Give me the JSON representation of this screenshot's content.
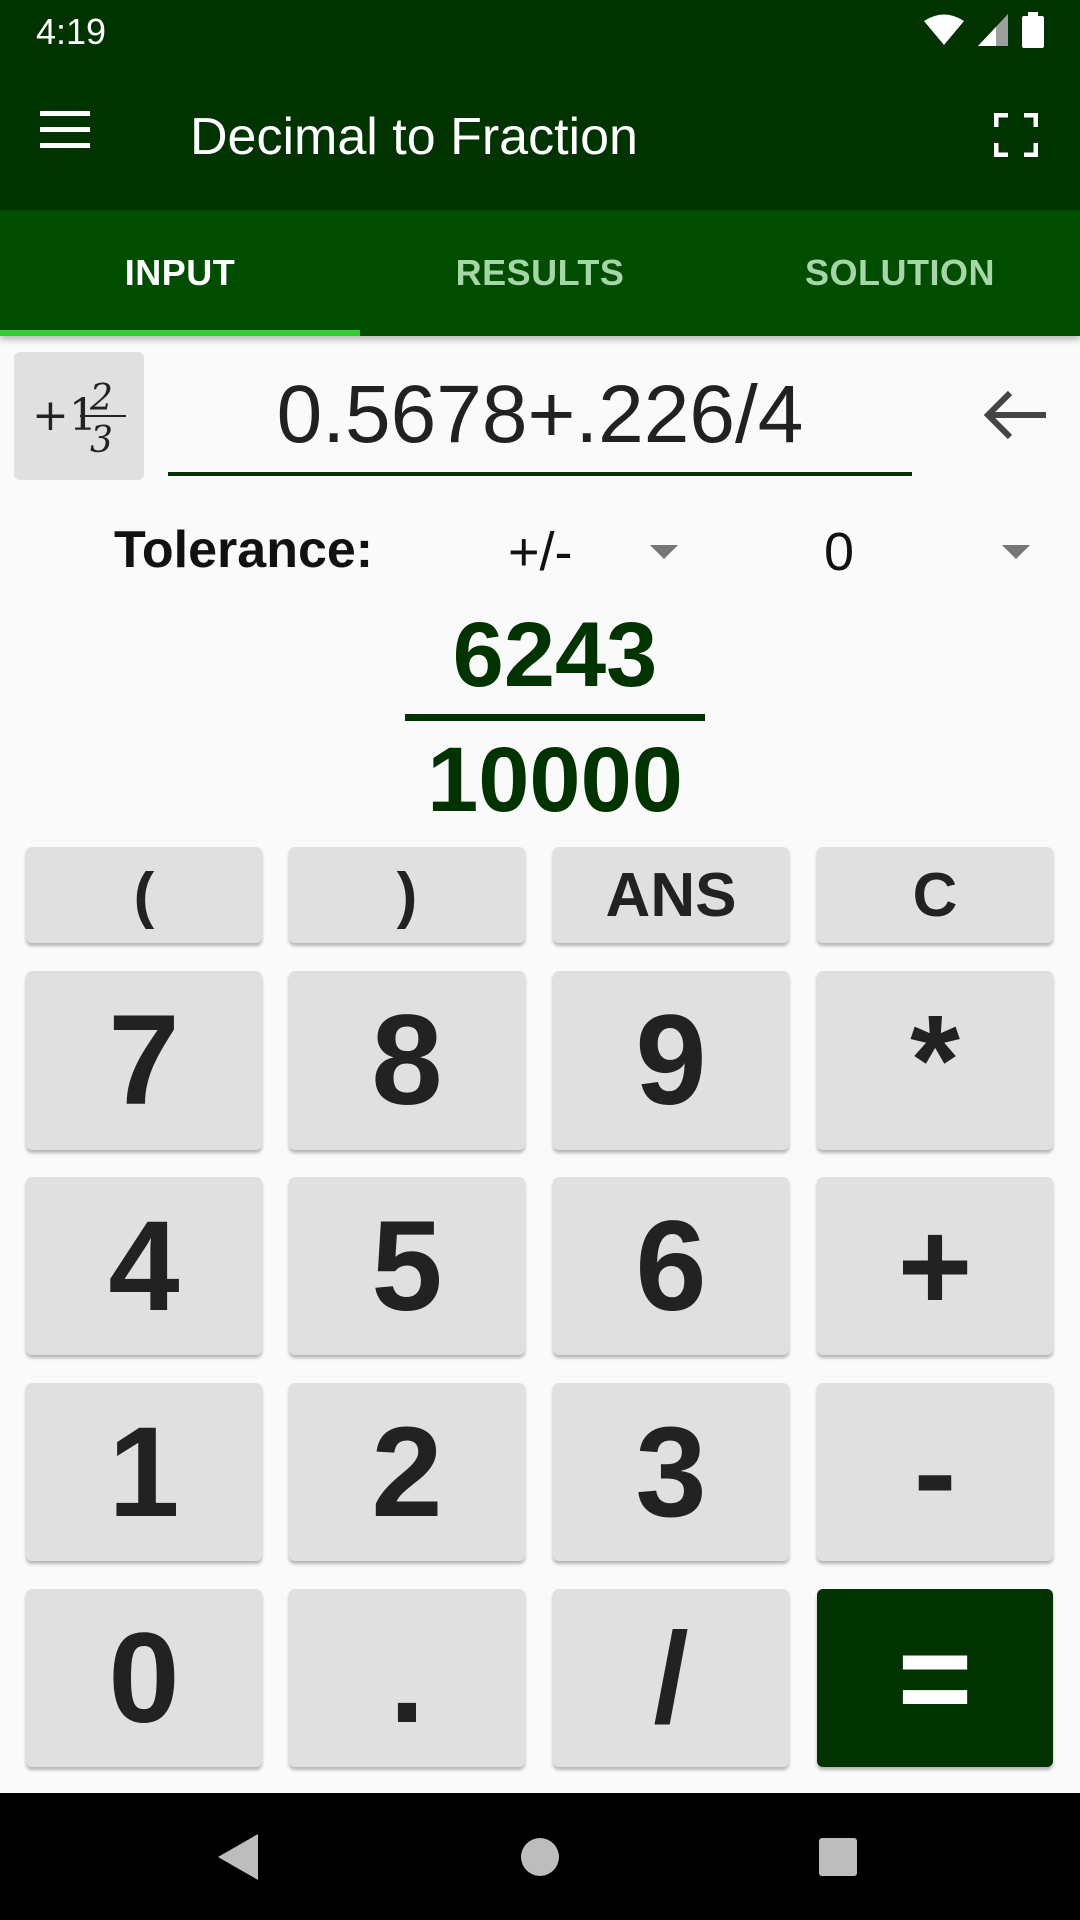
{
  "status_bar": {
    "time": "4:19"
  },
  "app_bar": {
    "title": "Decimal to Fraction"
  },
  "tabs": [
    {
      "label": "INPUT",
      "active": true
    },
    {
      "label": "RESULTS",
      "active": false
    },
    {
      "label": "SOLUTION",
      "active": false
    }
  ],
  "input": {
    "value": "0.5678+.226/4"
  },
  "tolerance": {
    "label": "Tolerance:",
    "mode": "+/-",
    "value": "0"
  },
  "result": {
    "numerator": "6243",
    "denominator": "10000"
  },
  "mixed_fraction_icon": {
    "whole": "+1",
    "numerator": "2",
    "denominator": "3"
  },
  "keypad": {
    "row1": [
      "(",
      ")",
      "ANS",
      "C"
    ],
    "row2": [
      "7",
      "8",
      "9",
      "*"
    ],
    "row3": [
      "4",
      "5",
      "6",
      "+"
    ],
    "row4": [
      "1",
      "2",
      "3",
      "-"
    ],
    "row5": [
      "0",
      ".",
      "/",
      "="
    ]
  },
  "colors": {
    "primary_dark": "#003300",
    "tab_bar": "#004d00",
    "tab_indicator": "#33cc33",
    "key_bg": "#e0e0e0"
  }
}
